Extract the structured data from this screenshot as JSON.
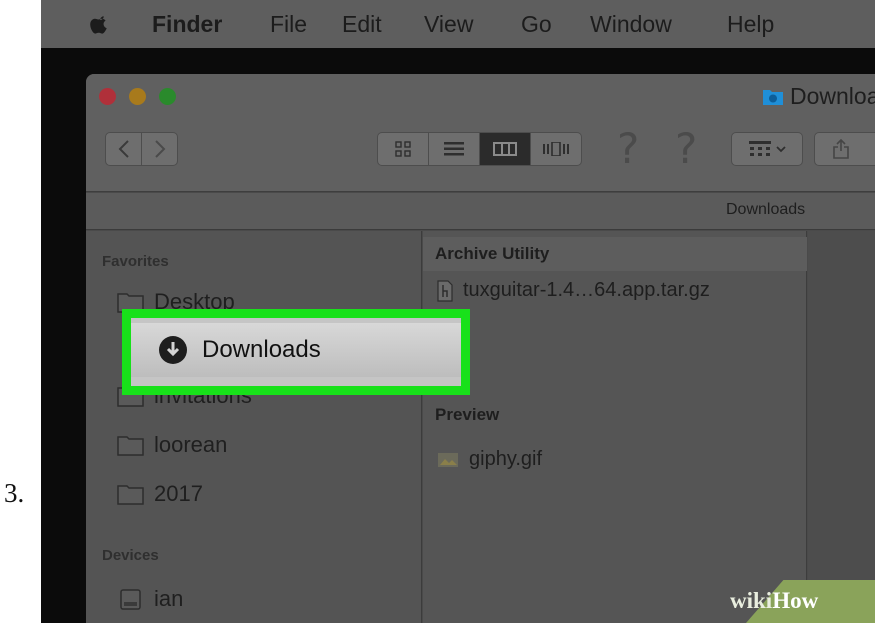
{
  "step": {
    "number": "3."
  },
  "menubar": {
    "items": [
      "Finder",
      "File",
      "Edit",
      "View",
      "Go",
      "Window",
      "Help"
    ]
  },
  "window": {
    "title": "Downloads",
    "help_glyphs": [
      "?",
      "?"
    ]
  },
  "pathbar": {
    "current": "Downloads"
  },
  "sidebar": {
    "favorites_header": "Favorites",
    "devices_header": "Devices",
    "items": [
      {
        "label": "Desktop",
        "icon": "folder-icon"
      },
      {
        "label": "Downloads",
        "icon": "download-circle-icon"
      },
      {
        "label": "invitations",
        "icon": "folder-icon"
      },
      {
        "label": "loorean",
        "icon": "folder-icon"
      },
      {
        "label": "2017",
        "icon": "folder-icon"
      }
    ],
    "devices": [
      {
        "label": "ian",
        "icon": "hard-drive-icon"
      }
    ]
  },
  "column": {
    "groups": [
      {
        "header": "Archive Utility",
        "files": [
          "tuxguitar-1.4…64.app.tar.gz"
        ]
      },
      {
        "header": "Preview",
        "files": [
          "giphy.gif"
        ]
      }
    ]
  },
  "watermark": {
    "wiki": "wiki",
    "how": "How"
  },
  "colors": {
    "highlight": "#18e11a",
    "menubar": "#5e5e5e",
    "watermark": "#8aa35a"
  }
}
